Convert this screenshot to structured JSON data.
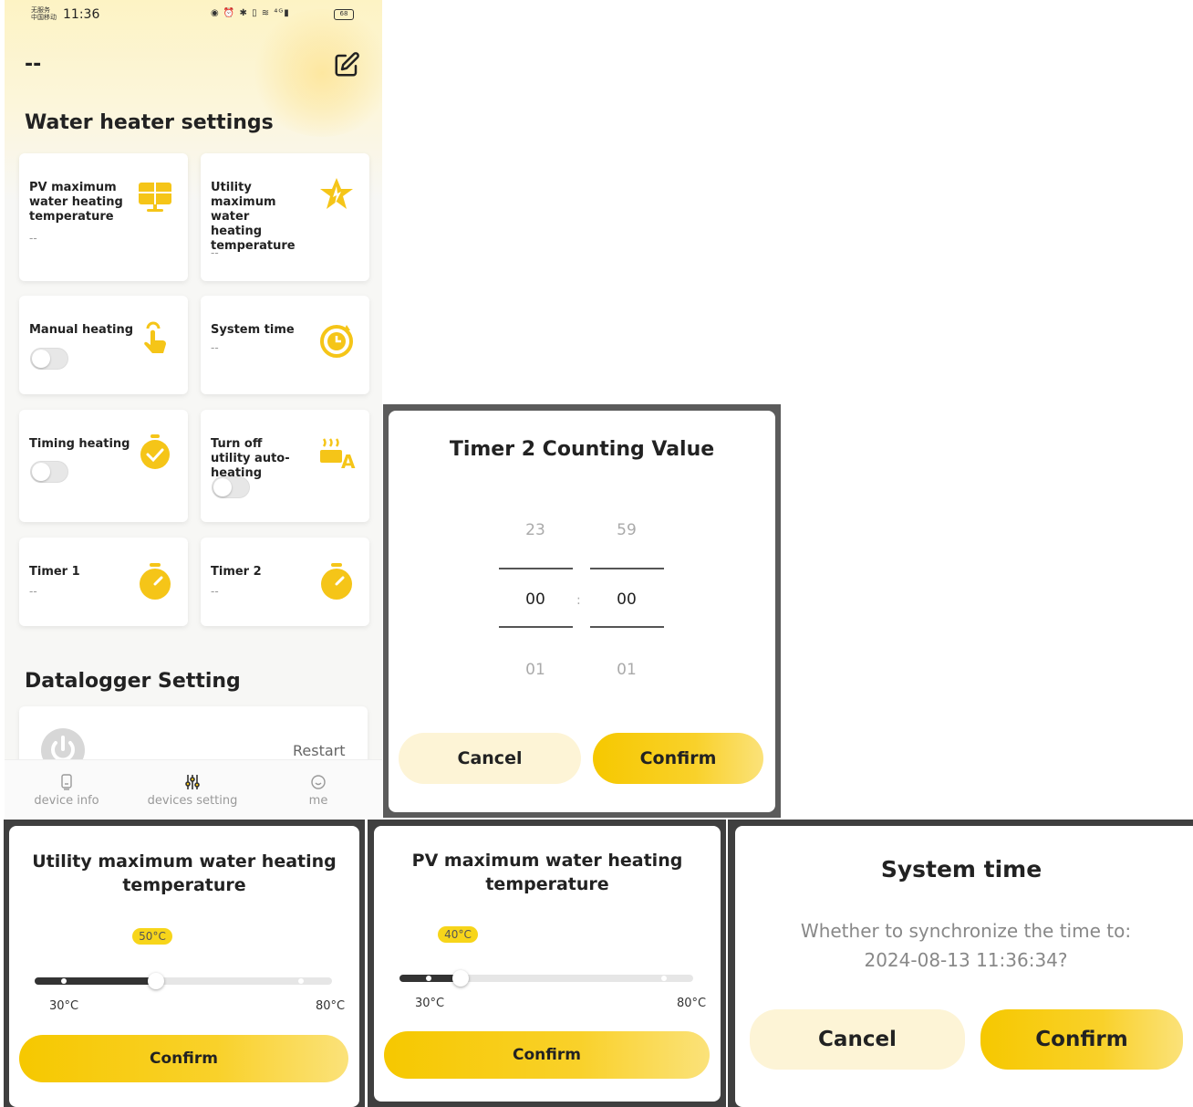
{
  "status_bar": {
    "carrier_line1": "无服务",
    "carrier_line2": "中国移动",
    "time": "11:36",
    "icons": "◉ ⏰ ✱ ▯ ≋ ⁴ᴳ▮",
    "battery": "68"
  },
  "header": {
    "device_name": "--"
  },
  "water_heater": {
    "title": "Water heater settings",
    "pv_max": {
      "label": "PV maximum water heating temperature",
      "value": "--"
    },
    "utility_max": {
      "label": "Utility maximum water heating temperature",
      "value": "--"
    },
    "manual_heating": {
      "label": "Manual heating",
      "enabled": false
    },
    "system_time": {
      "label": "System time",
      "value": "--"
    },
    "timing_heating": {
      "label": "Timing heating",
      "enabled": false
    },
    "utility_auto_off": {
      "label": "Turn off utility auto-heating",
      "enabled": false
    },
    "timer1": {
      "label": "Timer 1",
      "value": "--"
    },
    "timer2": {
      "label": "Timer 2",
      "value": "--"
    }
  },
  "datalogger": {
    "title": "Datalogger Setting",
    "restart_label": "Restart"
  },
  "bottom_nav": {
    "items": [
      {
        "label": "device info",
        "icon": "device-icon",
        "active": false
      },
      {
        "label": "devices setting",
        "icon": "sliders-icon",
        "active": true
      },
      {
        "label": "me",
        "icon": "user-icon",
        "active": false
      }
    ]
  },
  "timer_dialog": {
    "title": "Timer 2 Counting Value",
    "hours": {
      "prev": "23",
      "selected": "00",
      "next": "01"
    },
    "minutes": {
      "prev": "59",
      "selected": "00",
      "next": "01"
    },
    "separator": ":",
    "cancel": "Cancel",
    "confirm": "Confirm"
  },
  "utility_dialog": {
    "title": "Utility maximum water heating temperature",
    "value_label": "50°C",
    "value": 50,
    "min_label": "30°C",
    "max_label": "80°C",
    "confirm": "Confirm"
  },
  "pv_dialog": {
    "title": "PV maximum water heating temperature",
    "value_label": "40°C",
    "value": 40,
    "min_label": "30°C",
    "max_label": "80°C",
    "confirm": "Confirm"
  },
  "system_time_dialog": {
    "title": "System time",
    "message_line1": "Whether to synchronize the time to:",
    "message_line2": "2024-08-13 11:36:34?",
    "cancel": "Cancel",
    "confirm": "Confirm"
  },
  "colors": {
    "accent": "#f6c800",
    "accent_light": "#fdf4d6",
    "icon_yellow": "#f5c518"
  }
}
